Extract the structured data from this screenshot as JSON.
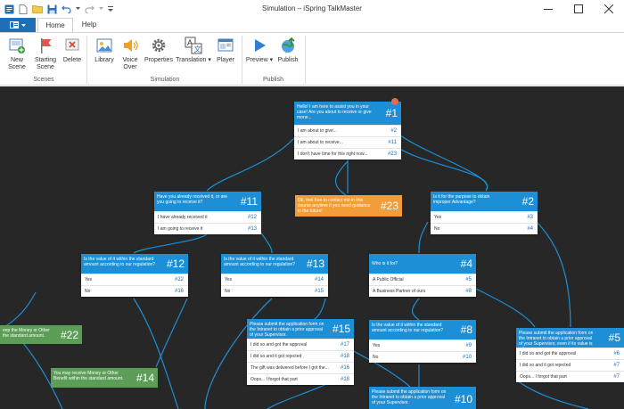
{
  "window": {
    "title": "Simulation – iSpring TalkMaster",
    "controls": [
      "minimize",
      "maximize",
      "close"
    ]
  },
  "tabs": {
    "home": "Home",
    "help": "Help"
  },
  "ribbon": {
    "buttons": {
      "new_scene": "New Scene",
      "starting_scene": "Starting Scene",
      "delete": "Delete",
      "library": "Library",
      "voice_over": "Voice Over",
      "properties": "Properties",
      "translation": "Translation",
      "player": "Player",
      "preview": "Preview",
      "publish": "Publish"
    },
    "groups": {
      "scenes": "Scenes",
      "simulation": "Simulation",
      "publish": "Publish"
    }
  },
  "colors": {
    "canvas": "#272727",
    "node_blue": "#1c8fd6",
    "node_orange": "#f39c3a",
    "node_green": "#5c9e57",
    "connector": "#1c8fd6",
    "file_button": "#1f6fb8"
  },
  "nodes": {
    "n1": {
      "header": "Hello! I am here to assist you in your case! Are you about to receive or give mone...",
      "num": "#1",
      "rows": [
        {
          "text": "I am about to give...",
          "num": "#2"
        },
        {
          "text": "I am about to receive...",
          "num": "#11"
        },
        {
          "text": "I don't have time for this right now...",
          "num": "#23"
        }
      ]
    },
    "n11": {
      "header": "Have you already received it, or are you going to receive it?",
      "num": "#11",
      "rows": [
        {
          "text": "I have already received it",
          "num": "#12"
        },
        {
          "text": "I am going to receive it",
          "num": "#13"
        }
      ]
    },
    "n23": {
      "header": "Ok, feel free to contact me in this course anytime if you need guidance in the future!",
      "num": "#23"
    },
    "n2": {
      "header": "Is it for the purpose to obtain improper Advantage?",
      "num": "#2",
      "rows": [
        {
          "text": "Yes",
          "num": "#3"
        },
        {
          "text": "No",
          "num": "#4"
        }
      ]
    },
    "n12": {
      "header": "Is the value of it within the standard amount according to our regulation?",
      "num": "#12",
      "rows": [
        {
          "text": "Yes",
          "num": "#22"
        },
        {
          "text": "No",
          "num": "#16"
        }
      ]
    },
    "n13": {
      "header": "Is the value of it within the standard amount according to our regulation?",
      "num": "#13",
      "rows": [
        {
          "text": "Yes",
          "num": "#14"
        },
        {
          "text": "No",
          "num": "#15"
        }
      ]
    },
    "n4": {
      "header": "Who is it for?",
      "num": "#4",
      "rows": [
        {
          "text": "A Public Official",
          "num": "#5"
        },
        {
          "text": "A Business Partner of ours",
          "num": "#8"
        }
      ]
    },
    "n22": {
      "header": "eep the Money or Other the standard amount.",
      "num": "#22"
    },
    "n14": {
      "header": "You may receive Money or Other Benefit within the standard amount.",
      "num": "#14"
    },
    "n15": {
      "header": "Please submit the application form on the Intranet to obtain a prior approval of your Supervisor.",
      "num": "#15",
      "rows": [
        {
          "text": "I did so and got the approval",
          "num": "#17"
        },
        {
          "text": "I did so and it got rejected",
          "num": "#18"
        },
        {
          "text": "The gift was delivered before I got the...",
          "num": "#16"
        },
        {
          "text": "Oops... I forgot that part",
          "num": "#18"
        }
      ]
    },
    "n8": {
      "header": "Is the value of it within the standard amount according to our regulation?",
      "num": "#8",
      "rows": [
        {
          "text": "Yes",
          "num": "#9"
        },
        {
          "text": "No",
          "num": "#10"
        }
      ]
    },
    "n5": {
      "header": "Please submit the application form on the Intranet to obtain a prior approval of your Supervisor, even if its value is wit...",
      "num": "#5",
      "rows": [
        {
          "text": "I did so and got the approval",
          "num": "#6"
        },
        {
          "text": "I did so and it got rejected",
          "num": "#7"
        },
        {
          "text": "Oops... I forgot that part",
          "num": "#7"
        }
      ]
    },
    "n10": {
      "header": "Please submit the application form on the Intranet to obtain a prior approval of your Supervisor.",
      "num": "#10"
    }
  }
}
